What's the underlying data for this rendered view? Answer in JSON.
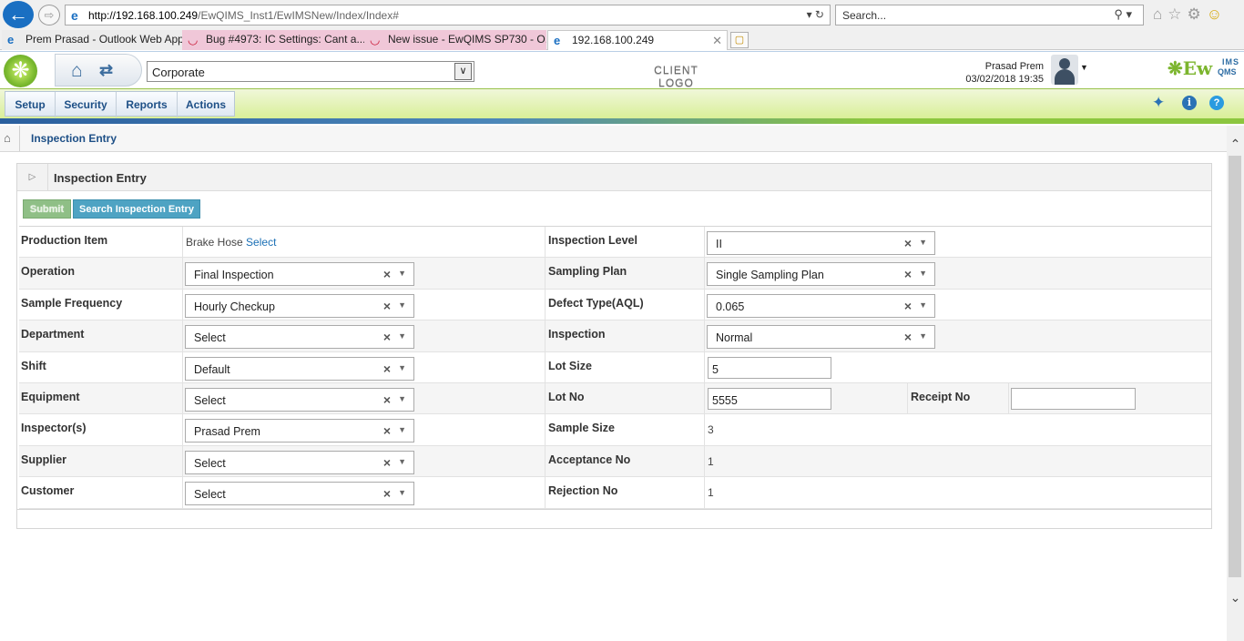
{
  "browser": {
    "url_host": "http://192.168.100.249",
    "url_path": "/EwQIMS_Inst1/EwIMSNew/Index/Index#",
    "search_placeholder": "Search...",
    "tabs": [
      {
        "label": "Prem Prasad - Outlook Web App",
        "icon": "ie-icon"
      },
      {
        "label": "Bug #4973: IC Settings: Cant a...",
        "icon": "redmine-icon"
      },
      {
        "label": "New issue - EwQIMS SP730 - O...",
        "icon": "redmine-icon"
      },
      {
        "label": "192.168.100.249",
        "icon": "ie-icon",
        "active": true
      }
    ]
  },
  "header": {
    "company_select": "Corporate",
    "client_logo": "CLIENT LOGO",
    "user_name": "Prasad Prem",
    "datetime": "03/02/2018 19:35",
    "brand_main": "Ew",
    "brand_sup": "IMS",
    "brand_sub": "QMS"
  },
  "menu": {
    "setup": "Setup",
    "security": "Security",
    "reports": "Reports",
    "actions": "Actions"
  },
  "breadcrumb": {
    "current": "Inspection Entry"
  },
  "panel": {
    "title": "Inspection Entry",
    "submit_label": "Submit",
    "search_label": "Search Inspection Entry"
  },
  "form": {
    "production_item": {
      "label": "Production Item",
      "value": "Brake Hose",
      "link": "Select"
    },
    "inspection_level": {
      "label": "Inspection Level",
      "value": "II"
    },
    "operation": {
      "label": "Operation",
      "value": "Final Inspection"
    },
    "sampling_plan": {
      "label": "Sampling Plan",
      "value": "Single Sampling Plan"
    },
    "sample_frequency": {
      "label": "Sample Frequency",
      "value": "Hourly Checkup"
    },
    "defect_type": {
      "label": "Defect Type(AQL)",
      "value": "0.065"
    },
    "department": {
      "label": "Department",
      "value": "Select"
    },
    "inspection": {
      "label": "Inspection",
      "value": "Normal"
    },
    "shift": {
      "label": "Shift",
      "value": "Default"
    },
    "lot_size": {
      "label": "Lot Size",
      "value": "5"
    },
    "equipment": {
      "label": "Equipment",
      "value": "Select"
    },
    "lot_no": {
      "label": "Lot No",
      "value": "5555"
    },
    "receipt_no": {
      "label": "Receipt No",
      "value": ""
    },
    "inspectors": {
      "label": "Inspector(s)",
      "value": "Prasad Prem"
    },
    "sample_size": {
      "label": "Sample Size",
      "value": "3"
    },
    "supplier": {
      "label": "Supplier",
      "value": "Select"
    },
    "acceptance_no": {
      "label": "Acceptance No",
      "value": "1"
    },
    "customer": {
      "label": "Customer",
      "value": "Select"
    },
    "rejection_no": {
      "label": "Rejection No",
      "value": "1"
    }
  },
  "colors": {
    "menu_green": "#d9ef98",
    "brand_green": "#7cb52e",
    "nav_blue": "#1d4f86",
    "submit_green": "#8fbf86",
    "search_blue": "#4ea3c3"
  }
}
